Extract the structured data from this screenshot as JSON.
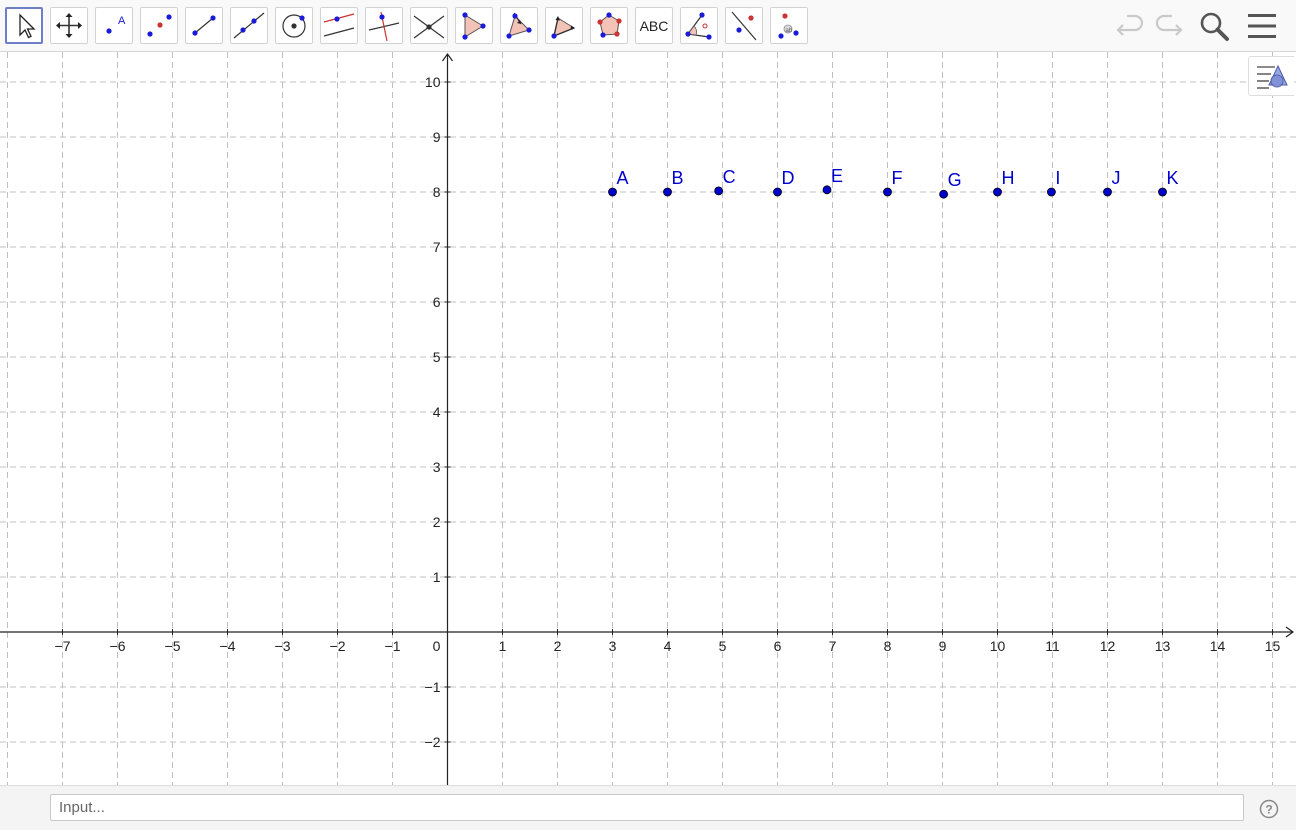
{
  "toolbar": {
    "tools": [
      {
        "id": "move",
        "icon": "pointer-arrow-icon",
        "active": true
      },
      {
        "id": "move-graphics",
        "icon": "four-way-arrow-icon"
      },
      {
        "id": "point",
        "icon": "point-icon"
      },
      {
        "id": "two-points",
        "icon": "two-points-icon"
      },
      {
        "id": "segment",
        "icon": "segment-icon"
      },
      {
        "id": "line",
        "icon": "line-icon"
      },
      {
        "id": "circle",
        "icon": "circle-center-point-icon"
      },
      {
        "id": "parallel",
        "icon": "parallel-line-icon"
      },
      {
        "id": "perpendicular",
        "icon": "perpendicular-line-icon"
      },
      {
        "id": "intersect",
        "icon": "intersect-icon"
      },
      {
        "id": "polygon",
        "icon": "polygon-icon"
      },
      {
        "id": "reflect",
        "icon": "reflect-icon"
      },
      {
        "id": "vector-polygon",
        "icon": "vector-polygon-icon"
      },
      {
        "id": "regular-polygon",
        "icon": "regular-polygon-icon"
      },
      {
        "id": "text",
        "icon": "text-icon",
        "label": "ABC"
      },
      {
        "id": "angle",
        "icon": "angle-icon"
      },
      {
        "id": "line-through-points",
        "icon": "line-two-points-icon"
      },
      {
        "id": "show-hide",
        "icon": "show-hide-object-icon"
      }
    ],
    "right": {
      "undo": "undo-icon",
      "redo": "redo-icon",
      "search": "search-icon",
      "menu": "menu-icon"
    }
  },
  "graphics": {
    "x_ticks": [
      "−7",
      "−6",
      "−5",
      "−4",
      "−3",
      "−2",
      "−1",
      "0",
      "1",
      "2",
      "3",
      "4",
      "5",
      "6",
      "7",
      "8",
      "9",
      "10",
      "11",
      "12",
      "13",
      "14",
      "15"
    ],
    "y_ticks": [
      "10",
      "9",
      "8",
      "7",
      "6",
      "5",
      "4",
      "3",
      "2",
      "1",
      "−1",
      "−2"
    ],
    "grid": true,
    "points": [
      {
        "label": "A",
        "x": 3,
        "y": 8
      },
      {
        "label": "B",
        "x": 4,
        "y": 8
      },
      {
        "label": "C",
        "x": 4.93,
        "y": 8.02
      },
      {
        "label": "D",
        "x": 6,
        "y": 8
      },
      {
        "label": "E",
        "x": 6.9,
        "y": 8.04
      },
      {
        "label": "F",
        "x": 8,
        "y": 8
      },
      {
        "label": "G",
        "x": 9.02,
        "y": 7.96
      },
      {
        "label": "H",
        "x": 10,
        "y": 8
      },
      {
        "label": "I",
        "x": 10.98,
        "y": 8
      },
      {
        "label": "J",
        "x": 12,
        "y": 8
      },
      {
        "label": "K",
        "x": 13,
        "y": 8
      }
    ],
    "point_color": "#0000cc",
    "grid_color": "#c0c0c0"
  },
  "style_bar": {
    "icon": "style-bar-toggle-icon"
  },
  "input_bar": {
    "placeholder": "Input...",
    "help": "help-icon"
  }
}
